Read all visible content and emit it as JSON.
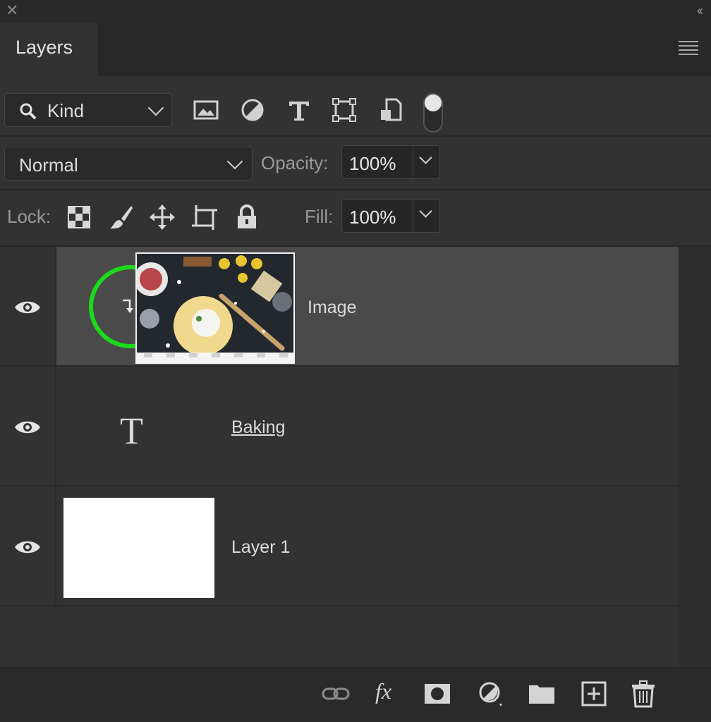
{
  "panel": {
    "tab_label": "Layers"
  },
  "filter": {
    "kind_label": "Kind",
    "icons": [
      "pixel-layer-filter-icon",
      "adjustment-layer-filter-icon",
      "type-layer-filter-icon",
      "shape-layer-filter-icon",
      "smart-object-filter-icon"
    ]
  },
  "blend": {
    "mode": "Normal",
    "opacity_label": "Opacity:",
    "opacity_value": "100%"
  },
  "lock": {
    "label": "Lock:",
    "icons": [
      "lock-transparent-pixels-icon",
      "lock-image-pixels-icon",
      "lock-position-icon",
      "lock-artboard-icon",
      "lock-all-icon"
    ],
    "fill_label": "Fill:",
    "fill_value": "100%"
  },
  "layers": [
    {
      "name": "Image",
      "type": "image",
      "visible": true,
      "selected": true,
      "clipped": true
    },
    {
      "name": "Baking",
      "type": "text",
      "visible": true,
      "selected": false
    },
    {
      "name": "Layer 1",
      "type": "fill",
      "visible": true,
      "selected": false
    }
  ],
  "colors": {
    "panel_bg": "#323232",
    "selected_row": "#4a4a4a",
    "highlight_circle": "#1adb1a"
  },
  "footer": {
    "icons": [
      "link-layers-icon",
      "layer-style-fx-icon",
      "add-mask-icon",
      "adjustment-layer-icon",
      "new-group-icon",
      "new-layer-icon",
      "delete-layer-icon"
    ],
    "fx_label": "fx"
  }
}
